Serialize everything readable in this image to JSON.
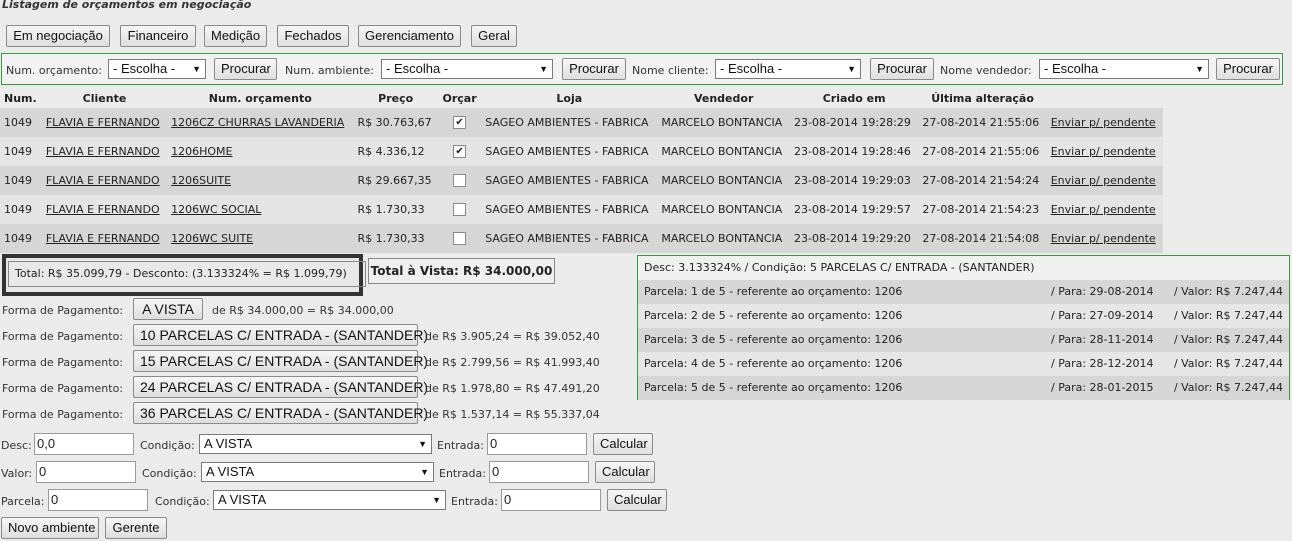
{
  "page_title": "Listagem de orçamentos em negociação",
  "tabs": [
    "Em negociação",
    "Financeiro",
    "Medição",
    "Fechados",
    "Gerenciamento",
    "Geral"
  ],
  "search": {
    "num_orcamento_label": "Num. orçamento:",
    "num_orcamento_value": "- Escolha -",
    "num_ambiente_label": "Num. ambiente:",
    "num_ambiente_value": "- Escolha -",
    "nome_cliente_label": "Nome cliente:",
    "nome_cliente_value": "- Escolha -",
    "nome_vendedor_label": "Nome vendedor:",
    "nome_vendedor_value": "- Escolha -",
    "button_label": "Procurar"
  },
  "table": {
    "headers": [
      "Num.",
      "Cliente",
      "Num. orçamento",
      "Preço",
      "Orçar",
      "Loja",
      "Vendedor",
      "Criado em",
      "Última alteração",
      ""
    ],
    "rows": [
      {
        "num": "1049",
        "cliente": "FLAVIA E FERNANDO",
        "orcamento": "1206CZ CHURRAS LAVANDERIA",
        "preco": "R$ 30.763,67",
        "orcar": true,
        "loja": "SAGEO AMBIENTES - FABRICA",
        "vendedor": "MARCELO BONTANCIA",
        "criado": "23-08-2014 19:28:29",
        "alterado": "27-08-2014 21:55:06",
        "acao": "Enviar p/ pendente"
      },
      {
        "num": "1049",
        "cliente": "FLAVIA E FERNANDO",
        "orcamento": "1206HOME",
        "preco": "R$ 4.336,12",
        "orcar": true,
        "loja": "SAGEO AMBIENTES - FABRICA",
        "vendedor": "MARCELO BONTANCIA",
        "criado": "23-08-2014 19:28:46",
        "alterado": "27-08-2014 21:55:06",
        "acao": "Enviar p/ pendente"
      },
      {
        "num": "1049",
        "cliente": "FLAVIA E FERNANDO",
        "orcamento": "1206SUITE",
        "preco": "R$ 29.667,35",
        "orcar": false,
        "loja": "SAGEO AMBIENTES - FABRICA",
        "vendedor": "MARCELO BONTANCIA",
        "criado": "23-08-2014 19:29:03",
        "alterado": "27-08-2014 21:54:24",
        "acao": "Enviar p/ pendente"
      },
      {
        "num": "1049",
        "cliente": "FLAVIA E FERNANDO",
        "orcamento": "1206WC SOCIAL",
        "preco": "R$ 1.730,33",
        "orcar": false,
        "loja": "SAGEO AMBIENTES - FABRICA",
        "vendedor": "MARCELO BONTANCIA",
        "criado": "23-08-2014 19:29:57",
        "alterado": "27-08-2014 21:54:23",
        "acao": "Enviar p/ pendente"
      },
      {
        "num": "1049",
        "cliente": "FLAVIA E FERNANDO",
        "orcamento": "1206WC SUITE",
        "preco": "R$ 1.730,33",
        "orcar": false,
        "loja": "SAGEO AMBIENTES - FABRICA",
        "vendedor": "MARCELO BONTANCIA",
        "criado": "23-08-2014 19:29:20",
        "alterado": "27-08-2014 21:54:08",
        "acao": "Enviar p/ pendente"
      }
    ]
  },
  "totals": {
    "summary": "Total: R$ 35.099,79 - Desconto: (3.133324% = R$ 1.099,79)",
    "total_a_vista": "Total à Vista: R$ 34.000,00"
  },
  "payments": [
    {
      "label": "Forma de Pagamento:",
      "method": "A VISTA",
      "detail": "de R$ 34.000,00 = R$ 34.000,00"
    },
    {
      "label": "Forma de Pagamento:",
      "method": "10 PARCELAS C/ ENTRADA - (SANTANDER)",
      "detail": "de R$ 3.905,24 = R$ 39.052,40"
    },
    {
      "label": "Forma de Pagamento:",
      "method": "15 PARCELAS C/ ENTRADA - (SANTANDER)",
      "detail": "de R$ 2.799,56 = R$ 41.993,40"
    },
    {
      "label": "Forma de Pagamento:",
      "method": "24 PARCELAS C/ ENTRADA - (SANTANDER)",
      "detail": "de R$ 1.978,80 = R$ 47.491,20"
    },
    {
      "label": "Forma de Pagamento:",
      "method": "36 PARCELAS C/ ENTRADA - (SANTANDER)",
      "detail": "de R$ 1.537,14 = R$ 55.337,04"
    }
  ],
  "installments": {
    "header": "Desc: 3.133324% / Condição: 5 PARCELAS C/ ENTRADA - (SANTANDER)",
    "rows": [
      {
        "parcela": "Parcela: 1 de 5 - referente ao orçamento: 1206",
        "para": "/ Para: 29-08-2014",
        "valor": "/ Valor: R$ 7.247,44"
      },
      {
        "parcela": "Parcela: 2 de 5 - referente ao orçamento: 1206",
        "para": "/ Para: 27-09-2014",
        "valor": "/ Valor: R$ 7.247,44"
      },
      {
        "parcela": "Parcela: 3 de 5 - referente ao orçamento: 1206",
        "para": "/ Para: 28-11-2014",
        "valor": "/ Valor: R$ 7.247,44"
      },
      {
        "parcela": "Parcela: 4 de 5 - referente ao orçamento: 1206",
        "para": "/ Para: 28-12-2014",
        "valor": "/ Valor: R$ 7.247,44"
      },
      {
        "parcela": "Parcela: 5 de 5 - referente ao orçamento: 1206",
        "para": "/ Para: 28-01-2015",
        "valor": "/ Valor: R$ 7.247,44"
      }
    ]
  },
  "calc": [
    {
      "label": "Desc:",
      "value": "0,0",
      "cond_label": "Condição:",
      "cond_value": "A VISTA",
      "entrada_label": "Entrada:",
      "entrada_value": "0",
      "button": "Calcular"
    },
    {
      "label": "Valor:",
      "value": "0",
      "cond_label": "Condição:",
      "cond_value": "A VISTA",
      "entrada_label": "Entrada:",
      "entrada_value": "0",
      "button": "Calcular"
    },
    {
      "label": "Parcela:",
      "value": "0",
      "cond_label": "Condição:",
      "cond_value": "A VISTA",
      "entrada_label": "Entrada:",
      "entrada_value": "0",
      "button": "Calcular"
    }
  ],
  "footer_buttons": [
    "Novo ambiente",
    "Gerente"
  ]
}
